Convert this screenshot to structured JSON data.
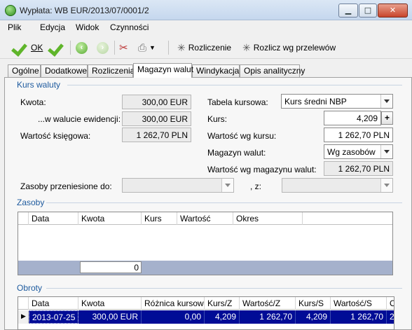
{
  "window": {
    "title": "Wypłata: WB EUR/2013/07/0001/2"
  },
  "menu": [
    "Plik",
    "Edycja",
    "Widok",
    "Czynności"
  ],
  "toolbar": {
    "ok_label": "OK",
    "rozliczenie_label": "Rozliczenie",
    "rozlicz_przelewow_label": "Rozlicz wg przelewów"
  },
  "tabs": [
    "Ogólne",
    "Dodatkowe",
    "Rozliczenia",
    "Magazyn walut",
    "Windykacja",
    "Opis analityczny"
  ],
  "kurs_waluty": {
    "section_title": "Kurs waluty",
    "kwota_label": "Kwota:",
    "kwota_value": "300,00 EUR",
    "ewidencji_label": "...w walucie ewidencji:",
    "ewidencji_value": "300,00 EUR",
    "wartosc_ksiegowa_label": "Wartość księgowa:",
    "wartosc_ksiegowa_value": "1 262,70 PLN",
    "tabela_label": "Tabela kursowa:",
    "tabela_value": "Kurs średni NBP",
    "kurs_label": "Kurs:",
    "kurs_value": "4,209",
    "wartosc_wg_kursu_label": "Wartość wg kursu:",
    "wartosc_wg_kursu_value": "1 262,70 PLN",
    "magazyn_label": "Magazyn walut:",
    "magazyn_value": "Wg zasobów",
    "wartosc_magazynu_label": "Wartość wg magazynu walut:",
    "wartosc_magazynu_value": "1 262,70 PLN",
    "zasoby_przeniesione_label": "Zasoby przeniesione do:",
    "z_label": ", z:"
  },
  "zasoby": {
    "section_title": "Zasoby",
    "columns": [
      "Data",
      "Kwota",
      "Kurs",
      "Wartość",
      "Okres"
    ],
    "total": "0"
  },
  "obroty": {
    "section_title": "Obroty",
    "columns": [
      "Data",
      "Kwota",
      "Różnica kursow",
      "Kurs/Z",
      "Wartość/Z",
      "Kurs/S",
      "Wartość/S",
      "O"
    ],
    "rows": [
      {
        "data": "2013-07-25",
        "kwota": "300,00 EUR",
        "roznica": "0,00",
        "kurs_z": "4,209",
        "wartosc_z": "1 262,70",
        "kurs_s": "4,209",
        "wartosc_s": "1 262,70",
        "o": "2"
      }
    ]
  }
}
